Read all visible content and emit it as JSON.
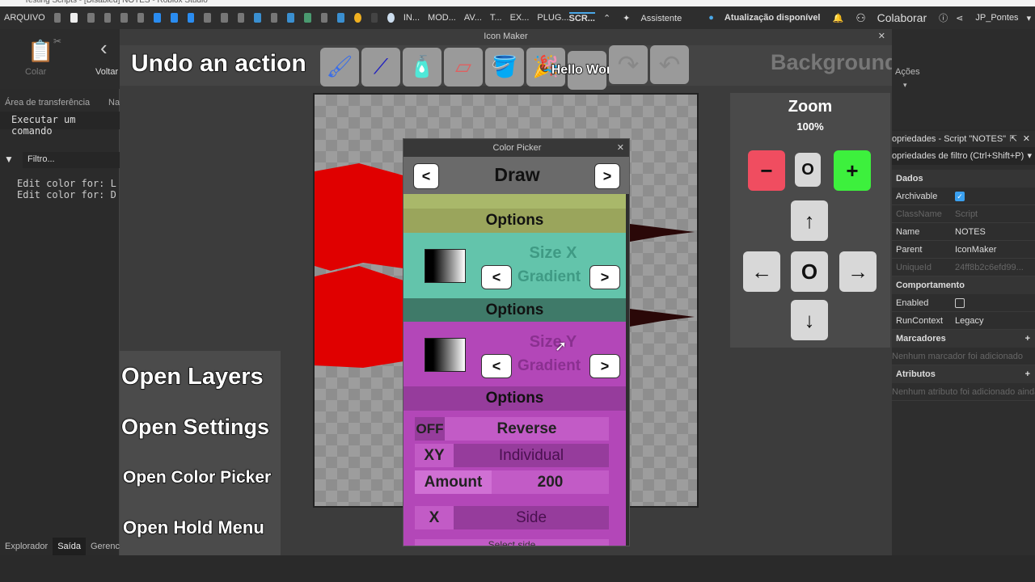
{
  "window": {
    "title": "Testing Scripts - [Disabled] NOTES - Roblox Studio"
  },
  "menubar": {
    "file": "ARQUIVO",
    "tabs": [
      "IN...",
      "MOD...",
      "AV...",
      "T...",
      "EX...",
      "PLUG...",
      "SCR..."
    ],
    "assistant": "Assistente",
    "update": "Atualização disponível",
    "collaborate": "Colaborar",
    "user": "JP_Pontes"
  },
  "ribbon": {
    "paste": "Colar",
    "back": "Voltar",
    "actions": "Ações"
  },
  "left": {
    "clipboard": "Área de transferência",
    "clip_cut": "Na",
    "command": "Executar um comando",
    "filter": "Filtro...",
    "output": [
      "Edit color for: L",
      "Edit color for: D"
    ],
    "tabs": [
      "Explorador",
      "Saída",
      "Gerencia"
    ]
  },
  "plugin": {
    "title": "Icon Maker",
    "tooltip": "Undo an action",
    "hello": "Hello World",
    "background": "Background",
    "tools": [
      "brush-icon",
      "line-icon",
      "spray-icon",
      "eraser-icon",
      "bucket-icon",
      "confetti-icon",
      "hello-world-icon",
      "redo-icon",
      "undo-icon"
    ]
  },
  "hints": [
    "Open Layers",
    "Open Settings",
    "Open Color Picker",
    "Open Hold Menu"
  ],
  "zoom": {
    "title": "Zoom",
    "level": "100%",
    "minus": "−",
    "reset": "O",
    "plus": "+",
    "center": "O",
    "up": "↑",
    "down": "↓",
    "left": "←",
    "right": "→"
  },
  "colorpicker": {
    "title": "Color Picker",
    "mode": "Draw",
    "prev": "<",
    "next": ">",
    "options": "Options",
    "size_x": "Size X",
    "size_y": "Size Y",
    "gradient": "Gradient",
    "reverse_state": "OFF",
    "reverse": "Reverse",
    "xy": "XY",
    "individual": "Individual",
    "amount_label": "Amount",
    "amount": "200",
    "side_axis": "X",
    "side": "Side",
    "select_side": "Select side",
    "colors": {
      "olive": "#a9b86a",
      "olive_dark": "#9aa55c",
      "teal": "#63c4ab",
      "teal_dark": "#3f7a69",
      "purple": "#b347b8",
      "purple_dark": "#963c9c"
    }
  },
  "properties": {
    "title": "opriedades - Script \"NOTES\"",
    "filter": "opriedades de filtro (Ctrl+Shift+P)",
    "sections": {
      "data": "Dados",
      "behavior": "Comportamento",
      "tags": "Marcadores",
      "attributes": "Atributos"
    },
    "rows": [
      {
        "k": "Archivable",
        "v": "checked"
      },
      {
        "k": "ClassName",
        "v": "Script"
      },
      {
        "k": "Name",
        "v": "NOTES"
      },
      {
        "k": "Parent",
        "v": "IconMaker"
      },
      {
        "k": "UniqueId",
        "v": "24ff8b2c6efd99..."
      }
    ],
    "enabled": "Enabled",
    "runcontext": "RunContext",
    "runcontext_value": "Legacy",
    "no_tags": "Nenhum marcador foi adicionado",
    "no_attrs": "Nenhum atributo foi adicionado ainda"
  }
}
